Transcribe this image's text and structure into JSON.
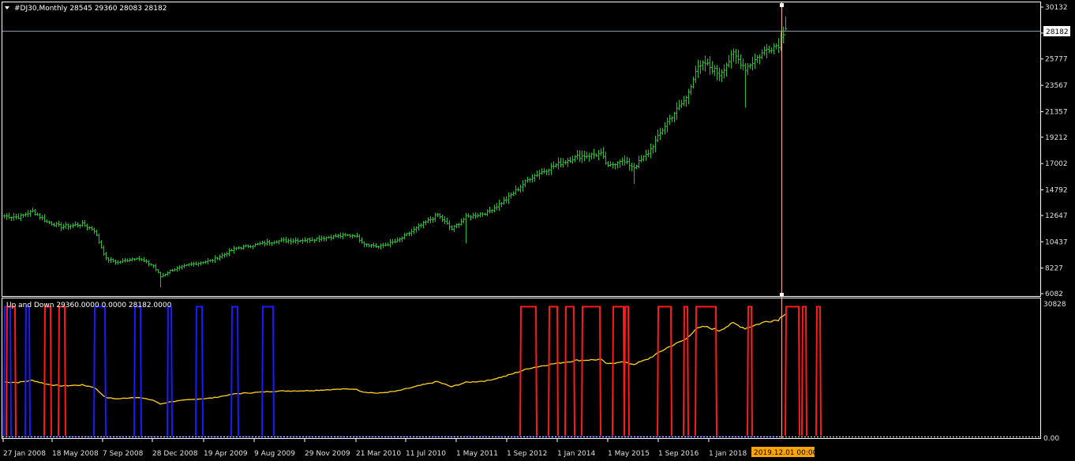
{
  "main_header": {
    "arrow": "▼",
    "text": "#DJ30,Monthly  28545 29360 28083 28182"
  },
  "indicator_header": {
    "text": "Up and Down 29360.0000 0.0000 28182.0000"
  },
  "current_price_label": "28182",
  "cursor_date_label": "2019.12.01 00:00",
  "price_axis": {
    "ticks": [
      "30132",
      "27955",
      "25777",
      "23567",
      "21357",
      "19212",
      "17002",
      "14792",
      "12647",
      "10437",
      "8227",
      "6082"
    ],
    "min": 6082,
    "max": 30132
  },
  "indicator_axis": {
    "top_label": "30828",
    "bottom_label": "0.00",
    "max": 30828
  },
  "time_axis": {
    "labels": [
      "27 Jan 2008",
      "18 May 2008",
      "7 Sep 2008",
      "28 Dec 2008",
      "19 Apr 2009",
      "9 Aug 2009",
      "29 Nov 2009",
      "21 Mar 2010",
      "11 Jul 2010",
      "1 May 2011",
      "1 Sep 2012",
      "1 Jan 2014",
      "1 May 2015",
      "1 Sep 2016",
      "1 Jan 2018"
    ]
  },
  "colors": {
    "background": "#000000",
    "bar": "#22c02a",
    "blue_series": "#1a1aff",
    "red_series": "#ff1a1a",
    "yellow_series": "#ffd21e",
    "axis": "#ffffff",
    "grid_price_line": "#8899aa",
    "cursor_line": "#ffb090",
    "date_highlight": "#ffa500"
  },
  "chart_data": {
    "type": "ohlc",
    "timeframe": "Monthly",
    "symbol": "#DJ30",
    "last_bar": {
      "open": 28545,
      "high": 29360,
      "low": 28083,
      "close": 28182
    },
    "anchors": [
      {
        "i": 0,
        "v": 12600
      },
      {
        "i": 6,
        "v": 12500
      },
      {
        "i": 12,
        "v": 13000
      },
      {
        "i": 18,
        "v": 12100
      },
      {
        "i": 24,
        "v": 11700
      },
      {
        "i": 33,
        "v": 11900
      },
      {
        "i": 38,
        "v": 11400
      },
      {
        "i": 43,
        "v": 9000
      },
      {
        "i": 48,
        "v": 8700
      },
      {
        "i": 56,
        "v": 9100
      },
      {
        "i": 63,
        "v": 8400
      },
      {
        "i": 66,
        "v": 7500
      },
      {
        "i": 70,
        "v": 8000
      },
      {
        "i": 78,
        "v": 8500
      },
      {
        "i": 88,
        "v": 8900
      },
      {
        "i": 98,
        "v": 9900
      },
      {
        "i": 115,
        "v": 10500
      },
      {
        "i": 128,
        "v": 10600
      },
      {
        "i": 140,
        "v": 10900
      },
      {
        "i": 148,
        "v": 11000
      },
      {
        "i": 152,
        "v": 10300
      },
      {
        "i": 158,
        "v": 10000
      },
      {
        "i": 166,
        "v": 10500
      },
      {
        "i": 175,
        "v": 11700
      },
      {
        "i": 183,
        "v": 12700
      },
      {
        "i": 189,
        "v": 11500
      },
      {
        "i": 195,
        "v": 12500
      },
      {
        "i": 204,
        "v": 12900
      },
      {
        "i": 212,
        "v": 14000
      },
      {
        "i": 222,
        "v": 15800
      },
      {
        "i": 232,
        "v": 16800
      },
      {
        "i": 242,
        "v": 17600
      },
      {
        "i": 252,
        "v": 17800
      },
      {
        "i": 255,
        "v": 16700
      },
      {
        "i": 260,
        "v": 17300
      },
      {
        "i": 266,
        "v": 16700
      },
      {
        "i": 272,
        "v": 17900
      },
      {
        "i": 280,
        "v": 20500
      },
      {
        "i": 288,
        "v": 22500
      },
      {
        "i": 292,
        "v": 24800
      },
      {
        "i": 296,
        "v": 25400
      },
      {
        "i": 302,
        "v": 24500
      },
      {
        "i": 308,
        "v": 26200
      },
      {
        "i": 313,
        "v": 25000
      },
      {
        "i": 322,
        "v": 26600
      },
      {
        "i": 327,
        "v": 27000
      },
      {
        "i": 330,
        "v": 28545
      }
    ],
    "blue_spans": [
      [
        0,
        3
      ],
      [
        9,
        11
      ],
      [
        38,
        43
      ],
      [
        55,
        58
      ],
      [
        69,
        71
      ],
      [
        81,
        84
      ],
      [
        96,
        99
      ],
      [
        109,
        114
      ]
    ],
    "red_spans": [
      [
        1,
        5
      ],
      [
        17,
        20
      ],
      [
        23,
        26
      ],
      [
        218,
        225
      ],
      [
        230,
        234
      ],
      [
        237,
        241
      ],
      [
        244,
        252
      ],
      [
        257,
        262
      ],
      [
        262,
        264
      ],
      [
        276,
        282
      ],
      [
        287,
        289
      ],
      [
        292,
        301
      ],
      [
        314,
        316
      ],
      [
        330,
        336
      ],
      [
        337,
        339
      ],
      [
        343,
        345
      ]
    ],
    "bar_count": 331
  }
}
